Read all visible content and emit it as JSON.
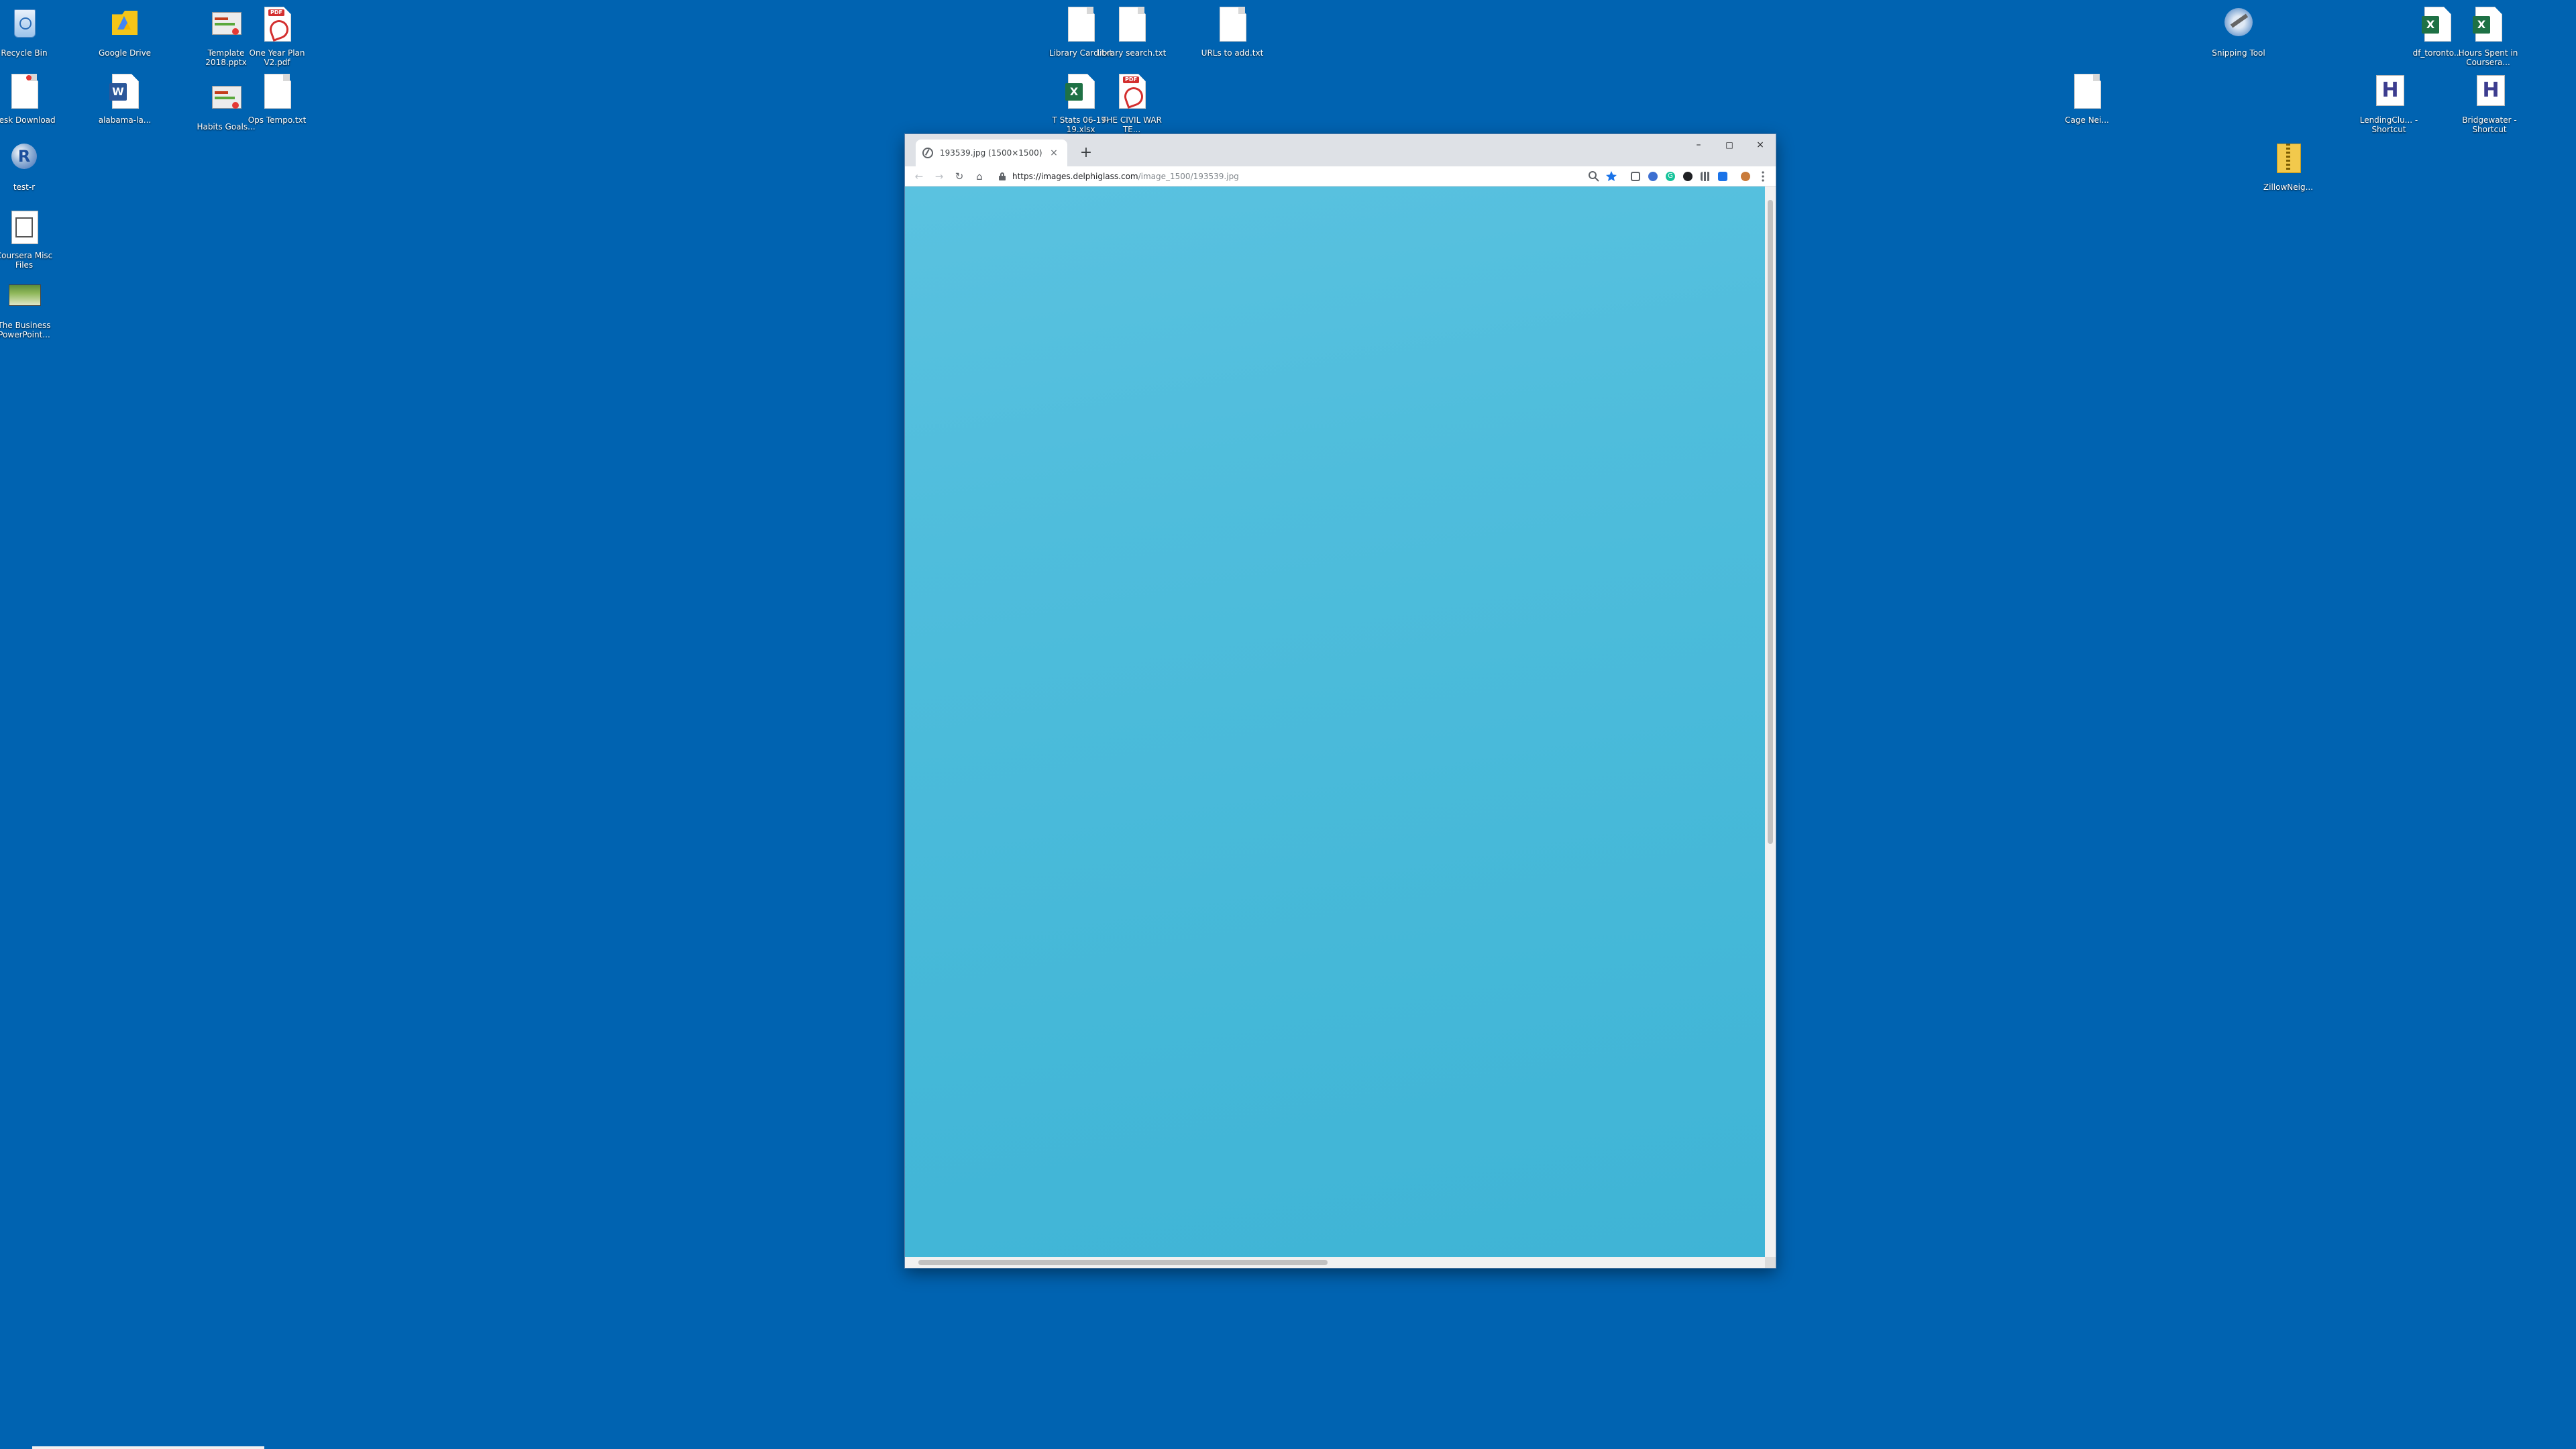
{
  "desktop": {
    "background": "#0063b1",
    "icons": [
      {
        "label": "Recycle Bin",
        "icon": "recycle-bin-icon"
      },
      {
        "label": "Google Drive",
        "icon": "google-drive-icon"
      },
      {
        "label": "Template 2018.pptx",
        "icon": "powerpoint-file-icon"
      },
      {
        "label": "One Year Plan V2.pdf",
        "icon": "pdf-file-icon"
      },
      {
        "label": "Desk Download",
        "icon": "document-icon"
      },
      {
        "label": "alabama-la...",
        "icon": "word-file-icon"
      },
      {
        "label": "Habits Goals...",
        "icon": "powerpoint-file-icon"
      },
      {
        "label": "Ops Tempo.txt",
        "icon": "text-file-icon"
      },
      {
        "label": "test-r",
        "icon": "r-app-icon"
      },
      {
        "label": "Coursera Misc Files",
        "icon": "folder-book-icon"
      },
      {
        "label": "The Business PowerPoint...",
        "icon": "slide-thumbnail-icon"
      },
      {
        "label": "Library Card.txt",
        "icon": "text-file-icon"
      },
      {
        "label": "library search.txt",
        "icon": "text-file-icon"
      },
      {
        "label": "URLs to add.txt",
        "icon": "text-file-icon"
      },
      {
        "label": "T Stats 06-19-19.xlsx",
        "icon": "excel-file-icon"
      },
      {
        "label": "THE CIVIL WAR TE...",
        "icon": "pdf-file-icon"
      },
      {
        "label": "Snipping Tool",
        "icon": "snipping-tool-icon"
      },
      {
        "label": "df_toronto...",
        "icon": "excel-file-icon"
      },
      {
        "label": "Hours Spent in Coursera...",
        "icon": "excel-file-icon"
      },
      {
        "label": "LendingClu... - Shortcut",
        "icon": "h-shortcut-icon"
      },
      {
        "label": "Bridgewater - Shortcut",
        "icon": "h-shortcut-icon"
      },
      {
        "label": "Cage Nei...",
        "icon": "text-file-icon"
      },
      {
        "label": "ZillowNeig...",
        "icon": "zip-folder-icon"
      }
    ]
  },
  "browser": {
    "tab_title": "193539.jpg (1500×1500)",
    "tab_close": "×",
    "new_tab": "+",
    "window_controls": {
      "minimize": "–",
      "maximize": "□",
      "close": "×"
    },
    "nav": {
      "back": "←",
      "forward": "→",
      "reload": "↻",
      "home": "⌂"
    },
    "url_host": "https://images.delphiglass.com",
    "url_path": "/image_1500/193539.jpg",
    "content_color": "#4cbcdc"
  }
}
